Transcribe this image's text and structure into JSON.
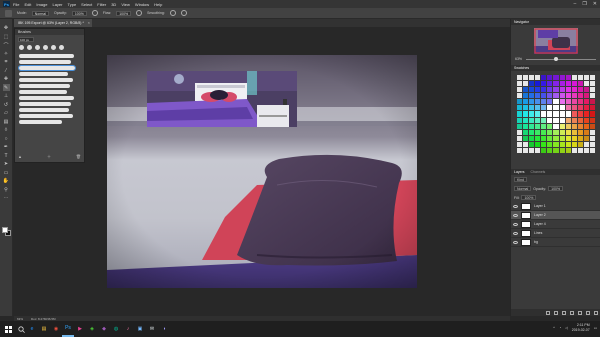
{
  "menubar": {
    "logo": "Ps",
    "items": [
      "File",
      "Edit",
      "Image",
      "Layer",
      "Type",
      "Select",
      "Filter",
      "3D",
      "View",
      "Window",
      "Help"
    ],
    "window_controls": [
      "–",
      "❐",
      "✕"
    ]
  },
  "options": {
    "mode_label": "Mode:",
    "mode_value": "Normal",
    "opacity_label": "Opacity:",
    "opacity_value": "100%",
    "flow_label": "Flow:",
    "flow_value": "100%",
    "smoothing_label": "Smoothing:"
  },
  "document": {
    "tab_title": "IBK 195 Export @ 63% (Layer 2, RGB/8) *",
    "zoom": "63%",
    "status": "Doc: 8.27M/36.5M"
  },
  "brushes_panel": {
    "title": "Brushes",
    "size_value": "100 px",
    "stroke_count": 12,
    "selected_index": 2
  },
  "navigator": {
    "tabs": [
      "Navigator"
    ],
    "zoom": "63%"
  },
  "color_panel": {
    "tabs": [
      "Swatches"
    ]
  },
  "layers": {
    "tabs": [
      "Layers",
      "Channels"
    ],
    "kind_label": "Kind",
    "blend_mode": "Normal",
    "opacity_label": "Opacity:",
    "opacity_value": "100%",
    "fill_label": "Fill:",
    "fill_value": "100%",
    "items": [
      {
        "name": "Layer 1",
        "active": false
      },
      {
        "name": "Layer 2",
        "active": true
      },
      {
        "name": "Layer 4",
        "active": false
      },
      {
        "name": "Lines",
        "active": false
      },
      {
        "name": "bg",
        "active": false
      }
    ]
  },
  "taskbar": {
    "apps": [
      "e",
      "▤",
      "◉",
      "Ps",
      "▶",
      "◈",
      "◆",
      "◍",
      "♪",
      "▣",
      "✉",
      "◑"
    ],
    "time": "2:11 PM",
    "date": "2019-02-07"
  },
  "colors": {
    "accent": "#31a8ff",
    "pillow": "#45354f",
    "sheet_red": "#d04458",
    "floor_purple": "#4d3b86"
  }
}
